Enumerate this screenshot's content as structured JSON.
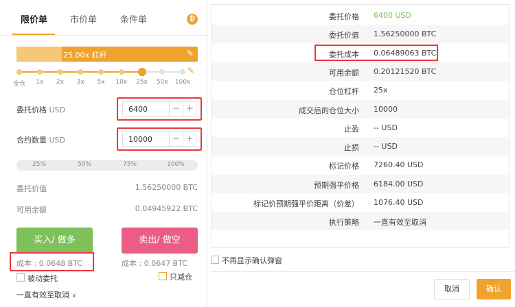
{
  "left": {
    "tabs": [
      {
        "label": "限价单",
        "active": true
      },
      {
        "label": "市价单",
        "active": false
      },
      {
        "label": "条件单",
        "active": false
      }
    ],
    "coin_icon": "bitcoin-icon",
    "leverage_label": "25.00x  杠杆",
    "leverage_ticks": [
      "全仓",
      "1x",
      "2x",
      "3x",
      "5x",
      "10x",
      "25x",
      "50x",
      "100x"
    ],
    "leverage_selected_index": 6,
    "price": {
      "label": "委托价格",
      "unit": "USD",
      "value": "6400",
      "minus": "−",
      "plus": "+"
    },
    "qty": {
      "label": "合约数量",
      "unit": "USD",
      "value": "10000",
      "minus": "−",
      "plus": "+"
    },
    "percents": [
      "25%",
      "50%",
      "75%",
      "100%"
    ],
    "order_value": {
      "label": "委托价值",
      "value": "1.56250000 BTC"
    },
    "available": {
      "label": "可用余额",
      "value": "0.04945922 BTC"
    },
    "buy_label": "买入/ 做多",
    "sell_label": "卖出/ 做空",
    "buy_cost": "成本 : 0.0648 BTC",
    "sell_cost": "成本 : 0.0647 BTC",
    "post_only": "被动委托",
    "reduce_only": "只减仓",
    "time_in_force": "一直有效至取消"
  },
  "right": {
    "rows": [
      {
        "key": "委托价格",
        "value": "6400 USD",
        "green": true
      },
      {
        "key": "委托价值",
        "value": "1.56250000 BTC"
      },
      {
        "key": "委托成本",
        "value": "0.06489063 BTC",
        "highlight": true
      },
      {
        "key": "可用余额",
        "value": "0.20121520 BTC"
      },
      {
        "key": "仓位杠杆",
        "value": "25x"
      },
      {
        "key": "成交后的仓位大小",
        "value": "10000"
      },
      {
        "key": "止盈",
        "value": "-- USD"
      },
      {
        "key": "止损",
        "value": "-- USD"
      },
      {
        "key": "标记价格",
        "value": "7260.40 USD"
      },
      {
        "key": "预期强平价格",
        "value": "6184.00 USD"
      },
      {
        "key": "标记价预期强平价距离（价差）",
        "value": "1076.40 USD"
      },
      {
        "key": "执行策略",
        "value": "一直有效至取消"
      }
    ],
    "dont_show_again": "不再显示确认弹窗",
    "cancel_label": "取消",
    "confirm_label": "确认"
  },
  "colors": {
    "accent": "#f0a32c",
    "buy": "#7ec15b",
    "sell": "#ea5d84",
    "highlight": "#e8383d",
    "price_green": "#7ec15b"
  }
}
